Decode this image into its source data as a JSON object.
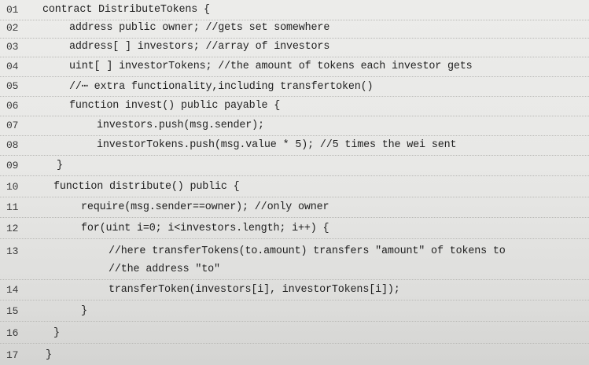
{
  "code": {
    "lines": [
      {
        "num": "01",
        "text": "contract DistributeTokens {"
      },
      {
        "num": "02",
        "text": "address public owner; //gets set somewhere"
      },
      {
        "num": "03",
        "text": "address[ ] investors; //array of investors"
      },
      {
        "num": "04",
        "text": "uint[ ] investorTokens; //the amount of tokens each investor gets"
      },
      {
        "num": "05",
        "text": "//⋯ extra functionality,including transfertoken()"
      },
      {
        "num": "06",
        "text": "function invest() public payable {"
      },
      {
        "num": "07",
        "text": "investors.push(msg.sender);"
      },
      {
        "num": "08",
        "text": "investorTokens.push(msg.value * 5); //5 times the wei sent"
      },
      {
        "num": "09",
        "text": "}"
      },
      {
        "num": "10",
        "text": "function distribute() public {"
      },
      {
        "num": "11",
        "text": "require(msg.sender==owner); //only owner"
      },
      {
        "num": "12",
        "text": "for(uint i=0; i<investors.length; i++) {"
      },
      {
        "num": "13",
        "text": "//here transferTokens(to.amount) transfers \"amount\" of tokens to"
      },
      {
        "num": "",
        "text": "//the address \"to\""
      },
      {
        "num": "14",
        "text": "transferToken(investors[i], investorTokens[i]);"
      },
      {
        "num": "15",
        "text": "}"
      },
      {
        "num": "16",
        "text": "}"
      },
      {
        "num": "17",
        "text": "}"
      }
    ]
  }
}
